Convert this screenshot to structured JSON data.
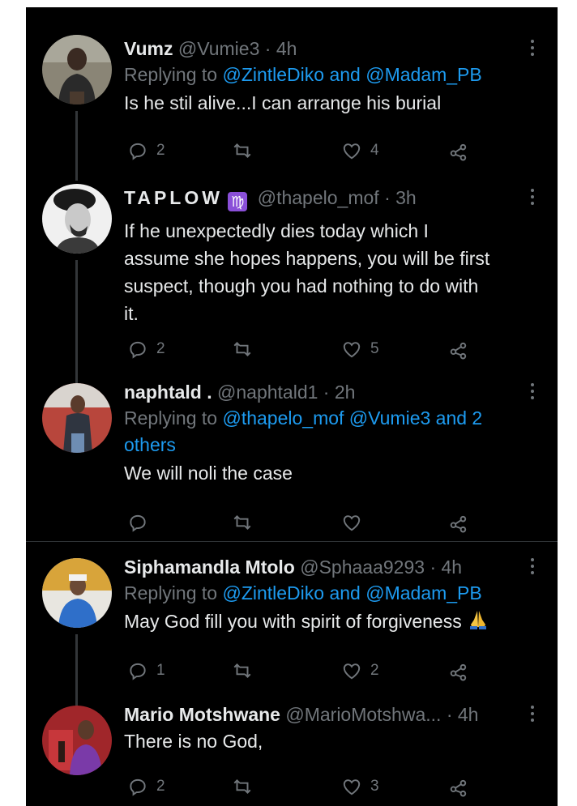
{
  "tweets": [
    {
      "name": "Vumz",
      "handle": "@Vumie3",
      "time": "· 4h",
      "replying_prefix": "Replying to",
      "replying_mentions": "@ZintleDiko and @Madam_PB",
      "text": "Is he stil alive...I can arrange his burial",
      "replies": "2",
      "retweets": "",
      "likes": "4"
    },
    {
      "name": "TAPLOW",
      "zodiac": "♍",
      "handle": "@thapelo_mof",
      "time": "· 3h",
      "text_lines": [
        "If he unexpectedly dies today which I",
        "assume she hopes happens, you will be first",
        "suspect, though you had nothing to do with",
        "it."
      ],
      "replies": "2",
      "retweets": "",
      "likes": "5"
    },
    {
      "name": "naphtald .",
      "handle": "@naphtald1",
      "time": "· 2h",
      "replying_prefix": "Replying to",
      "replying_mentions_line1": "@thapelo_mof @Vumie3 and 2",
      "replying_mentions_line2": "others",
      "text": "We will noli the case",
      "replies": "",
      "retweets": "",
      "likes": ""
    },
    {
      "name": "Siphamandla Mtolo",
      "handle": "@Sphaaa9293",
      "time": "· 4h",
      "replying_prefix": "Replying to",
      "replying_mentions": "@ZintleDiko and @Madam_PB",
      "text": "May God fill you with spirit of forgiveness",
      "emoji": "folded-hands",
      "replies": "1",
      "retweets": "",
      "likes": "2"
    },
    {
      "name": "Mario Motshwane",
      "handle": "@MarioMotshwa...",
      "time": "· 4h",
      "text": "There is no God,",
      "replies": "2",
      "retweets": "",
      "likes": "3"
    }
  ],
  "colors": {
    "background": "#000000",
    "primary_text": "#e7e9ea",
    "secondary_text": "#71767b",
    "mention": "#1d9bf0",
    "thread_line": "#333639"
  },
  "icons": [
    "reply-icon",
    "retweet-icon",
    "like-icon",
    "share-icon",
    "more-icon"
  ]
}
